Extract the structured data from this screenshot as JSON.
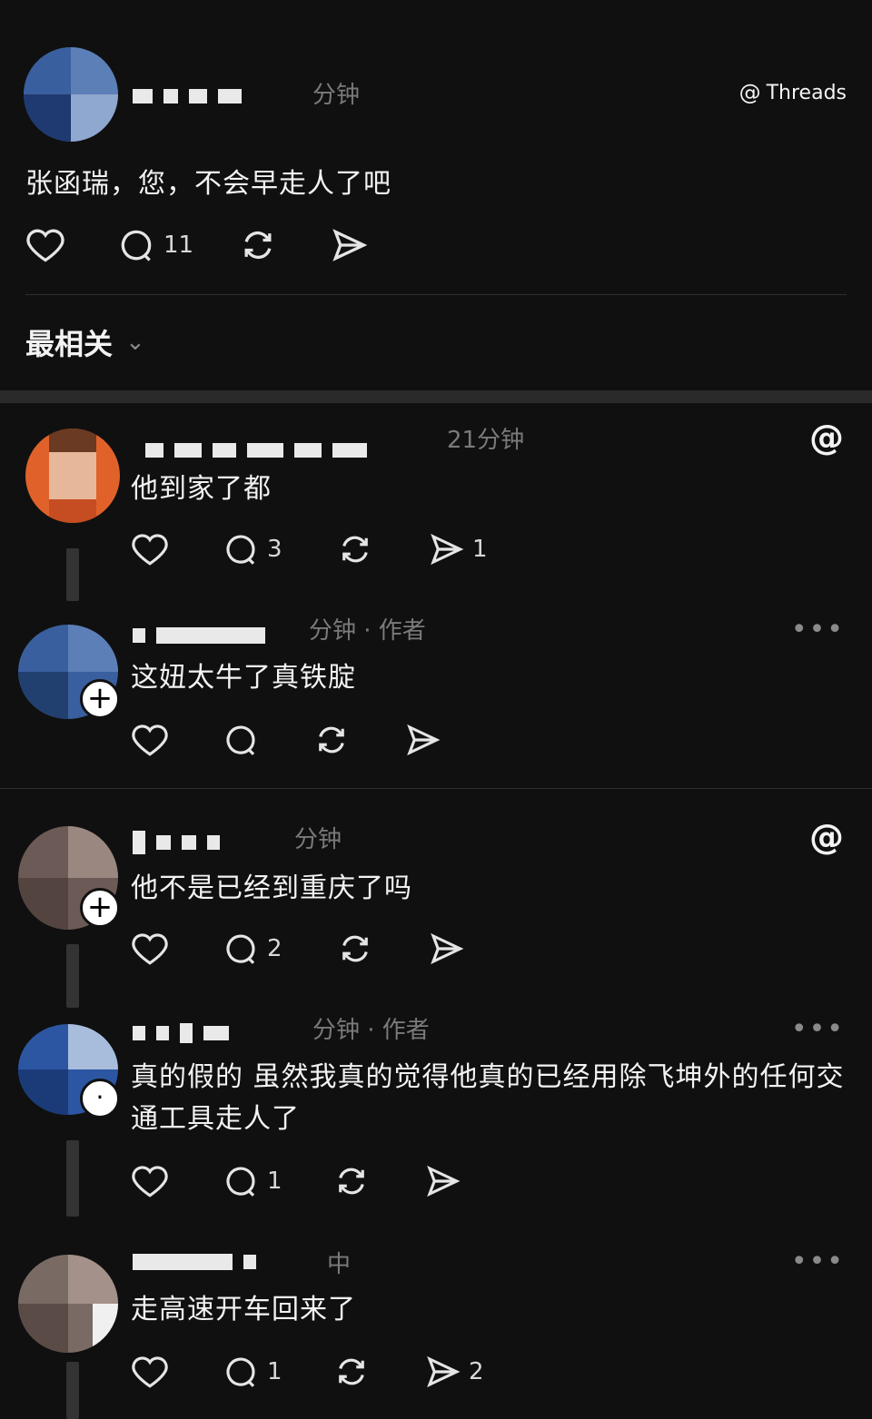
{
  "brand": {
    "label": "Threads",
    "icon": "threads-icon"
  },
  "post": {
    "time": "分钟",
    "text": "张函瑞，您，不会早走人了吧",
    "replies": "11"
  },
  "sort": {
    "label": "最相关",
    "icon": "chevron-down-icon"
  },
  "comments": [
    {
      "time": "21分钟",
      "text": "他到家了都",
      "replies": "3",
      "shares": "1",
      "badge": "threads-icon"
    },
    {
      "time": "分钟 · 作者",
      "text": "这妞太牛了真铁腚",
      "replies": "",
      "shares": "",
      "badge": "more-icon"
    },
    {
      "time": "分钟",
      "text": "他不是已经到重庆了吗",
      "replies": "2",
      "shares": "",
      "badge": "threads-icon"
    },
    {
      "time": "分钟 · 作者",
      "text_line1": "真的假的 虽然我真的觉得他真的已经用除飞坤外的任何交",
      "text_line2": "通工具走人了",
      "replies": "1",
      "shares": "",
      "badge": "more-icon"
    },
    {
      "time": "中",
      "text": "走高速开车回来了",
      "replies": "1",
      "shares": "2",
      "badge": "more-icon"
    }
  ],
  "more_label": "•••",
  "plus_label": "+",
  "colors": {
    "background": "#101010",
    "text": "#f3f3f3",
    "meta": "#7a7a7a"
  }
}
